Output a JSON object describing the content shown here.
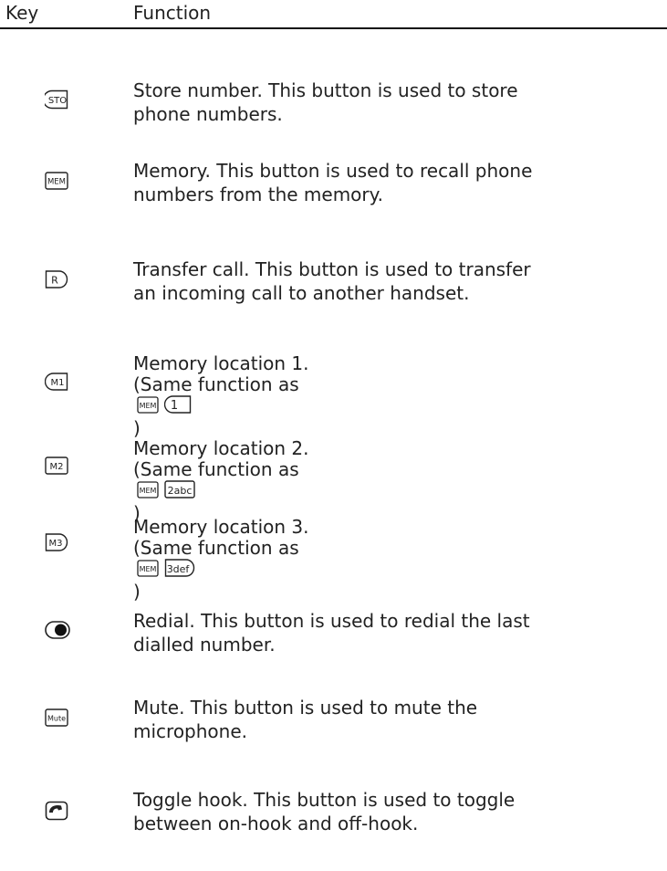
{
  "header": {
    "key": "Key",
    "function": "Function"
  },
  "rows": [
    {
      "icon": "sto-key-icon",
      "icon_label": "STO",
      "lines": [
        "Store number. This button is used to store",
        "phone numbers."
      ]
    },
    {
      "icon": "mem-key-icon",
      "icon_label": "MEM",
      "lines": [
        "Memory. This button is used to recall phone",
        "numbers from the memory."
      ]
    },
    {
      "icon": "r-key-icon",
      "icon_label": "R",
      "lines": [
        "Transfer call. This button is used to transfer",
        "an incoming call to another handset."
      ]
    },
    {
      "icon": "m1-key-icon",
      "icon_label": "M1",
      "line1": "Memory location 1.",
      "line2_prefix": "(Same function as",
      "line2_suffix": ")",
      "inline_keys": [
        "MEM",
        "1"
      ]
    },
    {
      "icon": "m2-key-icon",
      "icon_label": "M2",
      "line1": "Memory location 2.",
      "line2_prefix": "(Same function as",
      "line2_suffix": ")",
      "inline_keys": [
        "MEM",
        "2abc"
      ]
    },
    {
      "icon": "m3-key-icon",
      "icon_label": "M3",
      "line1": "Memory location 3.",
      "line2_prefix": "(Same function as",
      "line2_suffix": ")",
      "inline_keys": [
        "MEM",
        "3def"
      ]
    },
    {
      "icon": "redial-key-icon",
      "lines": [
        "Redial. This button is used to redial the last",
        "dialled number."
      ]
    },
    {
      "icon": "mute-key-icon",
      "icon_label": "Mute",
      "lines": [
        "Mute. This button is used to mute the",
        "microphone."
      ]
    },
    {
      "icon": "hook-key-icon",
      "lines": [
        "Toggle hook. This button is used to toggle",
        "between on-hook and off-hook."
      ]
    }
  ]
}
